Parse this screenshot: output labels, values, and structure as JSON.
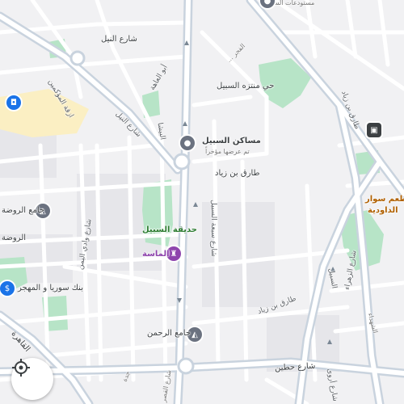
{
  "colors": {
    "background": "#f1f1f3",
    "road": "#ffffff",
    "arterial": "#c9d3de",
    "park": "#b7e4c7",
    "block": "#e6e6ea",
    "poi_purple": "#8e44ad",
    "poi_gray": "#6b7280",
    "poi_blue": "#1a73e8",
    "transit": "#3c4043"
  },
  "streets": {
    "nile_top": "شارع النيل",
    "nile_mid": "شارع النيل",
    "al_muwakkimin": "ازقة المؤكمين",
    "abu_al_ala": "أبو العاهة",
    "al_basha": "البيشا",
    "al_fajr": "الفجر ...",
    "tariq_ibn_ziyad_mid": "طارق بن زياد",
    "tariq_ibn_ziyad_right": "طارق بن زياد",
    "tariq_ibn_ziyad_low": "طارق بن زياد",
    "saba_al_sabeel": "شارع سبعة السبيل",
    "al_rawda": "الروضة",
    "al_sabeel": "السبيل",
    "al_zahraa": "شارع الزهراء",
    "hattin": "شارع حطين",
    "arwa": "شارع أروى",
    "al_qahira": "القاهرة",
    "bani_riyadh": "شارع وادي اليمن",
    "al_qasr": "شارع القصر",
    "jeddah": "جدة",
    "al_shuhada": "الشهداء",
    "al_dawoodiya": "الداودية"
  },
  "places": {
    "park_top": "حي منتزه السبيل",
    "masakin": "مساكن السبيل",
    "masakin_sub": "تم عرضها مؤخراً",
    "hadiqat": "حديقة السبيل",
    "almasa": "الماسة",
    "jami_rawda": "جامع الروضة",
    "bank": "بنك سوريا و المهجر",
    "jami_rahman": "جامع الرحمن",
    "matam": "مطعم سوار",
    "top_cut": "مستودعات السيار"
  },
  "icons": {
    "locate": "my-location-icon",
    "bus": "bus-stop-icon",
    "masakin": "map-pin-icon",
    "park_poi": "landmark-icon",
    "mosque": "mosque-icon",
    "bank": "bank-icon",
    "shopping": "shopping-bag-icon"
  }
}
